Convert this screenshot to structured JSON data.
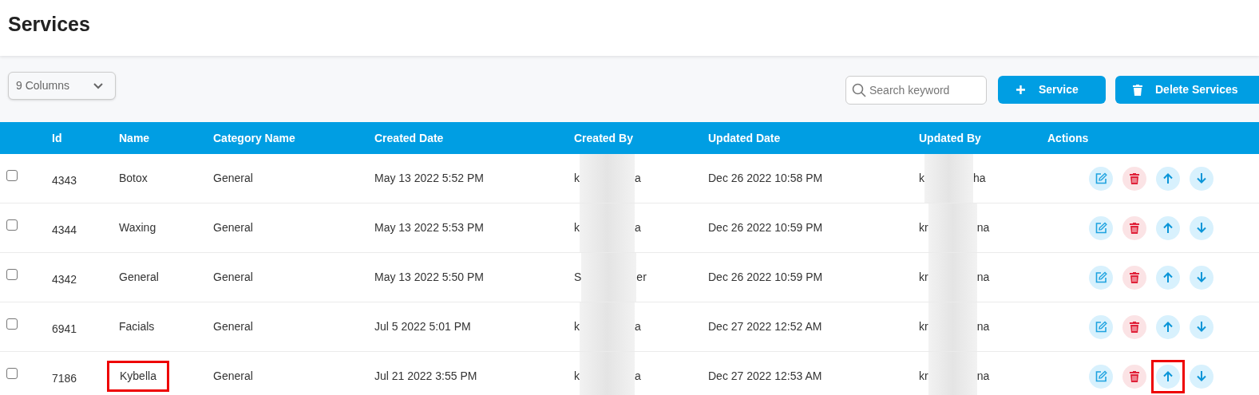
{
  "page_title": "Services",
  "columns_select": {
    "value": "9 Columns"
  },
  "search": {
    "placeholder": "Search keyword"
  },
  "buttons": [
    {
      "kind": "add",
      "label": "Service"
    },
    {
      "kind": "delete",
      "label": "Delete Services"
    }
  ],
  "table": {
    "columns": [
      "Id",
      "Name",
      "Category Name",
      "Created Date",
      "Created By",
      "Updated Date",
      "Updated By",
      "Actions"
    ],
    "rows": [
      {
        "checked": false,
        "id": "4343",
        "name": "Botox",
        "name_highlighted": false,
        "category": "General",
        "created_date": "May 13 2022 5:52 PM",
        "created_by": [
          "k",
          "a"
        ],
        "updated_date": "Dec 26 2022 10:58 PM",
        "updated_by": [
          "k",
          "ha"
        ],
        "up_highlighted": false
      },
      {
        "checked": false,
        "id": "4344",
        "name": "Waxing",
        "name_highlighted": false,
        "category": "General",
        "created_date": "May 13 2022 5:53 PM",
        "created_by": [
          "k",
          "a"
        ],
        "updated_date": "Dec 26 2022 10:59 PM",
        "updated_by": [
          "kr",
          "na"
        ],
        "up_highlighted": false
      },
      {
        "checked": false,
        "id": "4342",
        "name": "General",
        "name_highlighted": false,
        "category": "General",
        "created_date": "May 13 2022 5:50 PM",
        "created_by": [
          "S",
          "er"
        ],
        "updated_date": "Dec 26 2022 10:59 PM",
        "updated_by": [
          "kr",
          "na"
        ],
        "up_highlighted": false
      },
      {
        "checked": false,
        "id": "6941",
        "name": "Facials",
        "name_highlighted": false,
        "category": "General",
        "created_date": "Jul 5 2022 5:01 PM",
        "created_by": [
          "k",
          "a"
        ],
        "updated_date": "Dec 27 2022 12:52 AM",
        "updated_by": [
          "kr",
          "na"
        ],
        "up_highlighted": false
      },
      {
        "checked": false,
        "id": "7186",
        "name": "Kybella",
        "name_highlighted": true,
        "category": "General",
        "created_date": "Jul 21 2022 3:55 PM",
        "created_by": [
          "k",
          "a"
        ],
        "updated_date": "Dec 27 2022 12:53 AM",
        "updated_by": [
          "kr",
          "na"
        ],
        "up_highlighted": true
      }
    ]
  }
}
